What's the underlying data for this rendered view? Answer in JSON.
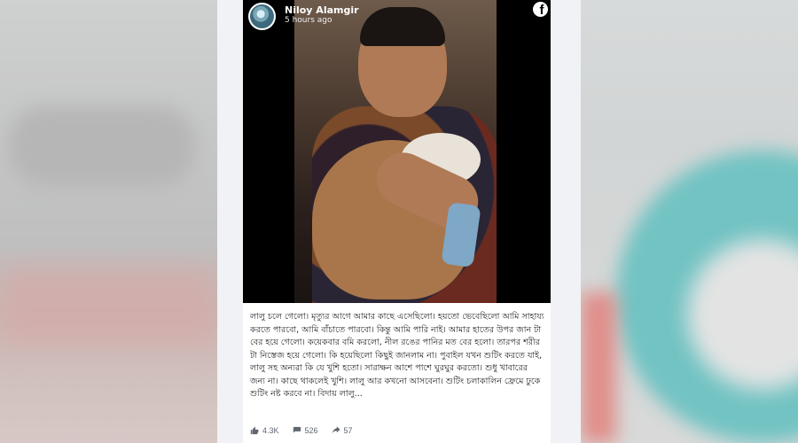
{
  "post": {
    "author": "Niloy Alamgir",
    "time": "5 hours ago",
    "brand_icon": "facebook-icon",
    "text": "লালু চলে গেলো। মৃত্যুর আগে আমার কাছে এসেছিলো। হয়তো ভেবেছিলো আমি সাহায্য করতে পারবো, আমি বাঁচাতে পারবো। কিন্তু আমি পারি নাই। আমার হাতের উপর জান টা বের হয়ে গেলো। কয়েকবার বমি করলো, নীল রঙের পানির মত বের হলো। তারপর শরীর টা নিস্তেজ হয়ে গেলো। কি হয়েছিলো কিছুই জানলাম না। পুবাইল যখন শুটিং করতে যাই, লালু সহ অন্যরা কি যে খুশি হতো। সারাক্ষন আশে পাশে ঘুরঘুর করতো। শুধু খাবারের জন্য না। কাছে থাকলেই খুশি। লালু আর কখনো আসবেনা। শুটিং চলাকালিন ফ্রেমে ঢুকে শুটিং নষ্ট করবে না। বিদায় লালু...",
    "stats": {
      "likes": "4.3K",
      "comments": "526",
      "shares": "57"
    }
  },
  "colors": {
    "accent": "#1877f2",
    "muted_text": "#606770"
  }
}
